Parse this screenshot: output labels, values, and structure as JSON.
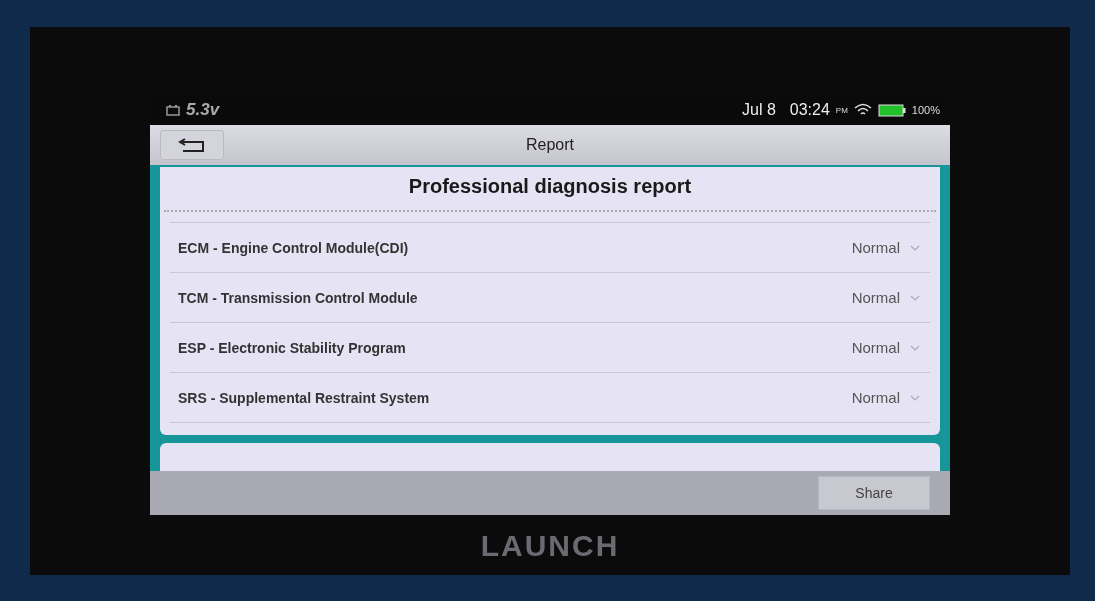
{
  "status_bar": {
    "voltage": "5.3v",
    "date": "Jul 8",
    "time": "03:24",
    "ampm": "PM",
    "battery": "100%"
  },
  "title_bar": {
    "title": "Report"
  },
  "report": {
    "heading": "Professional diagnosis report",
    "rows": [
      {
        "module": "ECM - Engine Control Module(CDI)",
        "status": "Normal"
      },
      {
        "module": "TCM - Transmission Control Module",
        "status": "Normal"
      },
      {
        "module": "ESP - Electronic Stability Program",
        "status": "Normal"
      },
      {
        "module": "SRS - Supplemental Restraint System",
        "status": "Normal"
      }
    ]
  },
  "bottom_bar": {
    "button": "Share"
  },
  "bezel_logo": "LAUNCH"
}
